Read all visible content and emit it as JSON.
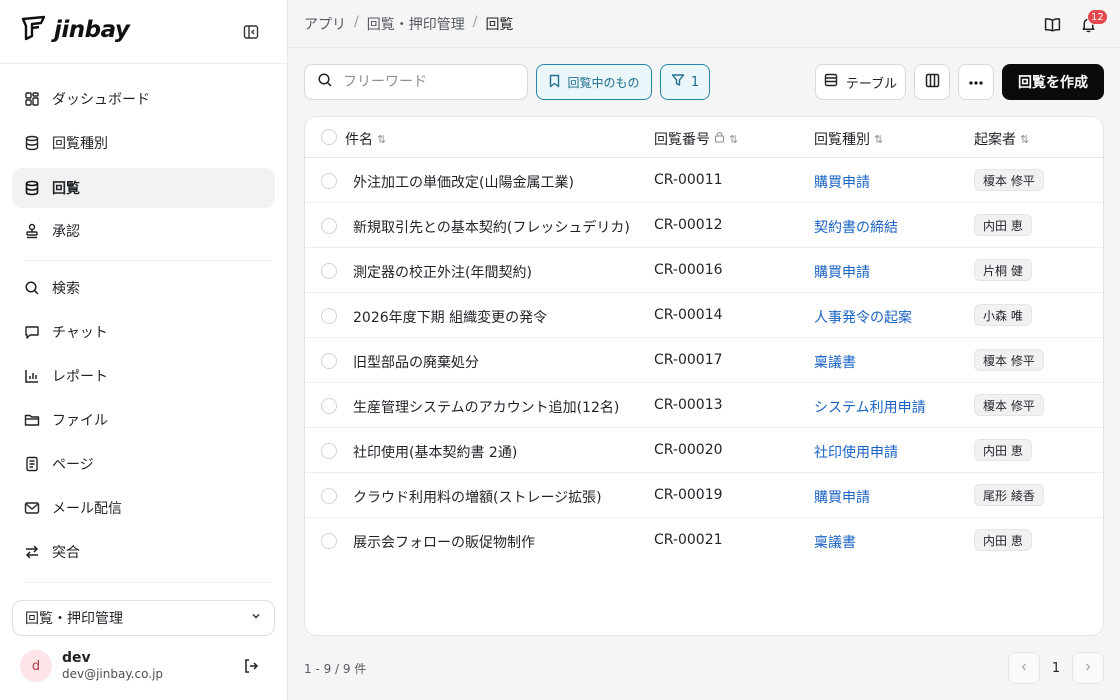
{
  "brand": {
    "name": "jinbay"
  },
  "sidebar": {
    "items": [
      {
        "label": "ダッシュボード",
        "icon": "dashboard-icon"
      },
      {
        "label": "回覧種別",
        "icon": "database-icon"
      },
      {
        "label": "回覧",
        "icon": "database-icon",
        "active": true
      },
      {
        "label": "承認",
        "icon": "stamp-icon"
      },
      {
        "label": "検索",
        "icon": "search-icon"
      },
      {
        "label": "チャット",
        "icon": "chat-icon"
      },
      {
        "label": "レポート",
        "icon": "chart-icon"
      },
      {
        "label": "ファイル",
        "icon": "folder-icon"
      },
      {
        "label": "ページ",
        "icon": "page-icon"
      },
      {
        "label": "メール配信",
        "icon": "mail-icon"
      },
      {
        "label": "突合",
        "icon": "swap-icon"
      }
    ],
    "workspace": "回覧・押印管理",
    "user": {
      "initial": "d",
      "name": "dev",
      "email": "dev@jinbay.co.jp"
    }
  },
  "header": {
    "breadcrumbs": [
      "アプリ",
      "回覧・押印管理",
      "回覧"
    ],
    "notification_count": "12"
  },
  "toolbar": {
    "search_placeholder": "フリーワード",
    "filter_saved_label": "回覧中のもの",
    "filter_count": "1",
    "table_view_label": "テーブル",
    "create_label": "回覧を作成"
  },
  "table": {
    "columns": [
      "件名",
      "回覧番号",
      "回覧種別",
      "起案者"
    ],
    "rows": [
      {
        "title": "外注加工の単価改定(山陽金属工業)",
        "number": "CR-00011",
        "type": "購買申請",
        "author": "榎本 修平"
      },
      {
        "title": "新規取引先との基本契約(フレッシュデリカ)",
        "number": "CR-00012",
        "type": "契約書の締結",
        "author": "内田 恵"
      },
      {
        "title": "測定器の校正外注(年間契約)",
        "number": "CR-00016",
        "type": "購買申請",
        "author": "片桐 健"
      },
      {
        "title": "2026年度下期 組織変更の発令",
        "number": "CR-00014",
        "type": "人事発令の起案",
        "author": "小森 唯"
      },
      {
        "title": "旧型部品の廃棄処分",
        "number": "CR-00017",
        "type": "稟議書",
        "author": "榎本 修平"
      },
      {
        "title": "生産管理システムのアカウント追加(12名)",
        "number": "CR-00013",
        "type": "システム利用申請",
        "author": "榎本 修平"
      },
      {
        "title": "社印使用(基本契約書 2通)",
        "number": "CR-00020",
        "type": "社印使用申請",
        "author": "内田 恵"
      },
      {
        "title": "クラウド利用料の増額(ストレージ拡張)",
        "number": "CR-00019",
        "type": "購買申請",
        "author": "尾形 綾香"
      },
      {
        "title": "展示会フォローの販促物制作",
        "number": "CR-00021",
        "type": "稟議書",
        "author": "内田 恵"
      }
    ]
  },
  "pagination": {
    "summary": "1 - 9 / 9 件",
    "current_page": "1"
  },
  "colors": {
    "accent": "#2b86a8",
    "link": "#1a63c4",
    "primary_button": "#0b0b0c",
    "badge": "#e5484d"
  }
}
